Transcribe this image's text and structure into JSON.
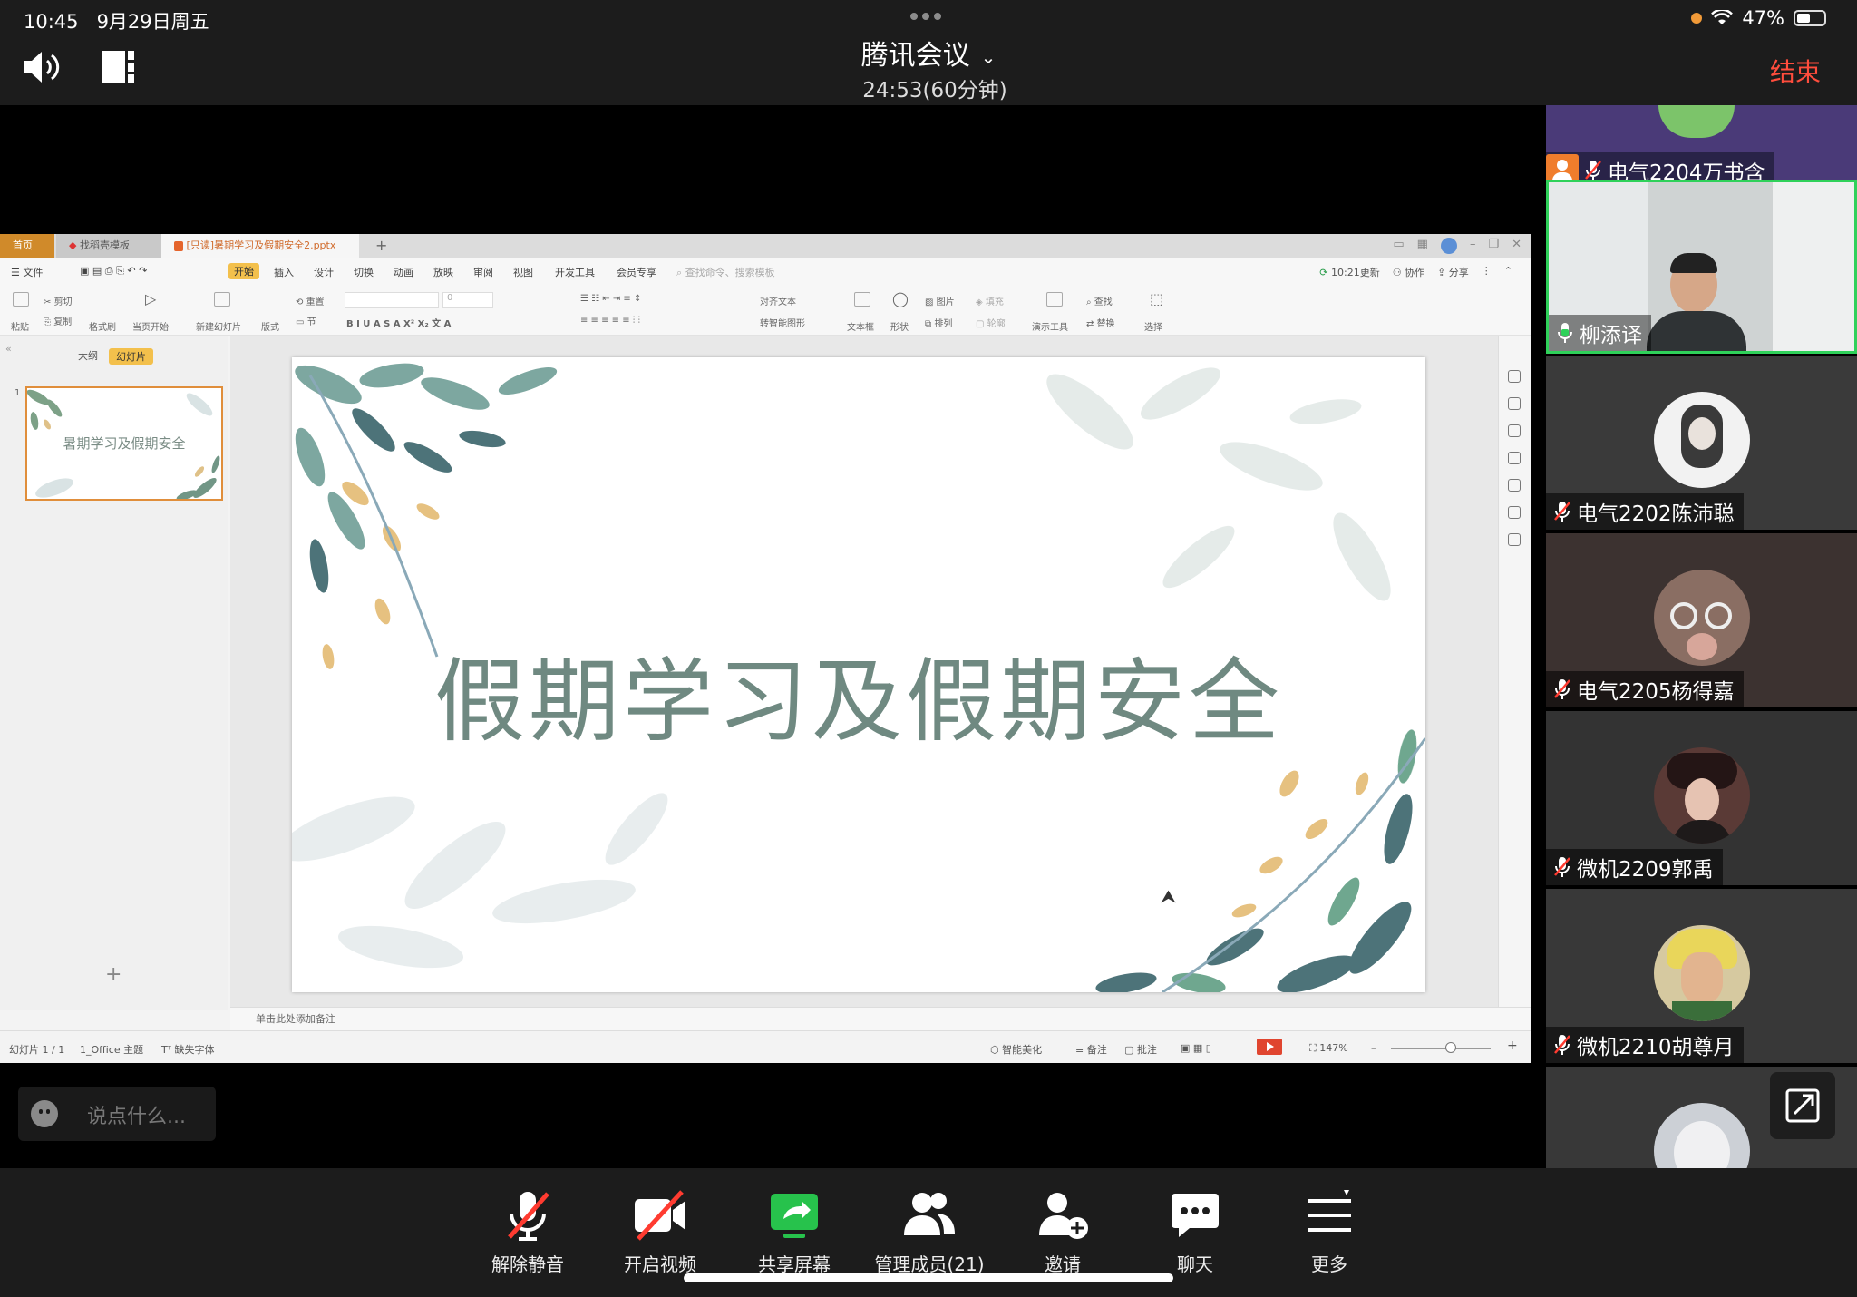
{
  "status_bar": {
    "time": "10:45",
    "date": "9月29日周五",
    "battery": "47%",
    "battery_level": 0.47
  },
  "meeting": {
    "title": "腾讯会议",
    "time_info": "24:53(60分钟)",
    "end_label": "结束"
  },
  "shared_app": {
    "tabs": {
      "home": "首页",
      "template": "找稻壳模板",
      "document": "[只读]暑期学习及假期安全2.pptx",
      "new_tab": "+"
    },
    "menu": {
      "file": "文件",
      "start": "开始",
      "insert": "插入",
      "design": "设计",
      "transition": "切换",
      "animation": "动画",
      "slideshow": "放映",
      "review": "审阅",
      "view": "视图",
      "devtools": "开发工具",
      "member": "会员专享",
      "search_placeholder": "查找命令、搜索模板",
      "update": "10:21更新",
      "collab": "协作",
      "share": "分享"
    },
    "ribbon": {
      "paste": "粘贴",
      "cut": "剪切",
      "copy": "复制",
      "format_painter": "格式刷",
      "from_current": "当页开始",
      "new_slide": "新建幻灯片",
      "layout": "版式",
      "section": "节",
      "reset": "重置",
      "font_size": "0",
      "align_text": "对齐文本",
      "smartart": "转智能图形",
      "textbox": "文本框",
      "shape": "形状",
      "picture": "图片",
      "arrange": "排列",
      "fill": "填充",
      "outline": "轮廓",
      "presentation_tools": "演示工具",
      "find": "查找",
      "replace": "替换",
      "select": "选择"
    },
    "outline_tabs": {
      "outline": "大纲",
      "slides": "幻灯片"
    },
    "slide_number": "1",
    "thumbnail_title": "暑期学习及假期安全",
    "slide_title": "假期学习及假期安全",
    "notes_placeholder": "单击此处添加备注",
    "status": {
      "slide_count": "幻灯片 1 / 1",
      "theme": "1_Office 主题",
      "missing_font": "缺失字体",
      "smart_beautify": "智能美化",
      "notes": "备注",
      "comments": "批注",
      "zoom": "147%"
    }
  },
  "chat": {
    "placeholder": "说点什么..."
  },
  "participants": [
    {
      "name": "电气2204万书含",
      "muted": true,
      "host": true
    },
    {
      "name": "柳添译",
      "muted": false,
      "active": true
    },
    {
      "name": "电气2202陈沛聪",
      "muted": true
    },
    {
      "name": "电气2205杨得嘉",
      "muted": true
    },
    {
      "name": "微机2209郭禹",
      "muted": true
    },
    {
      "name": "微机2210胡尊月",
      "muted": true
    }
  ],
  "toolbar": {
    "unmute": "解除静音",
    "video": "开启视频",
    "share": "共享屏幕",
    "members": "管理成员(21)",
    "invite": "邀请",
    "chat": "聊天",
    "more": "更多"
  },
  "colors": {
    "end_red": "#ff4d3d",
    "share_green": "#27c24c",
    "active_border": "#2fd15a",
    "host_orange": "#f07d2c"
  }
}
